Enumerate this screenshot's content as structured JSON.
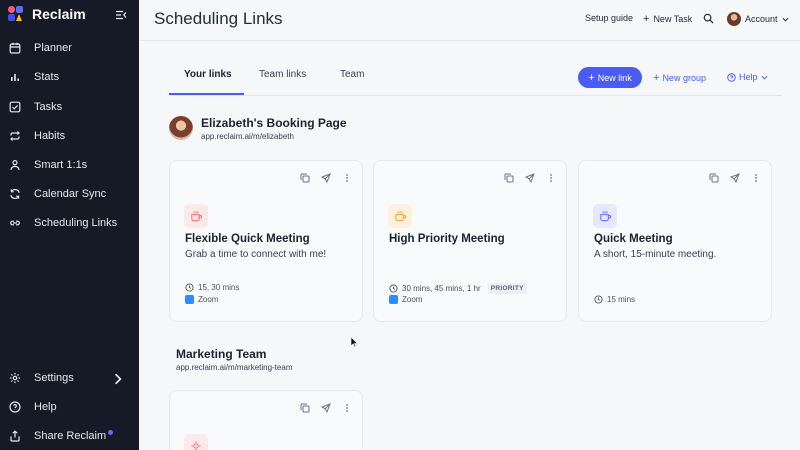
{
  "app": {
    "name": "Reclaim"
  },
  "sidebar": {
    "items": [
      {
        "label": "Planner",
        "icon": "calendar-icon"
      },
      {
        "label": "Stats",
        "icon": "bar-chart-icon"
      },
      {
        "label": "Tasks",
        "icon": "checkbox-icon"
      },
      {
        "label": "Habits",
        "icon": "repeat-icon"
      },
      {
        "label": "Smart 1:1s",
        "icon": "users-icon"
      },
      {
        "label": "Calendar Sync",
        "icon": "sync-icon"
      },
      {
        "label": "Scheduling Links",
        "icon": "link-icon"
      }
    ],
    "bottom": [
      {
        "label": "Settings",
        "icon": "gear-icon"
      },
      {
        "label": "Help",
        "icon": "help-circle-icon"
      },
      {
        "label": "Share Reclaim",
        "icon": "share-icon"
      }
    ]
  },
  "header": {
    "title": "Scheduling Links",
    "setup_guide": "Setup guide",
    "new_task": "New Task",
    "account": "Account"
  },
  "tabs": [
    {
      "label": "Your links",
      "active": true
    },
    {
      "label": "Team links",
      "active": false
    },
    {
      "label": "Team",
      "active": false
    }
  ],
  "actions": {
    "new_link": "New link",
    "new_group": "New group",
    "help": "Help"
  },
  "owner": {
    "name": "Elizabeth's Booking Page",
    "url": "app.reclaim.ai/m/elizabeth"
  },
  "cards": [
    {
      "title": "Flexible Quick Meeting",
      "description": "Grab a time to connect with me!",
      "durations": "15, 30 mins",
      "location": "Zoom",
      "mug_color": "#ff6b6b",
      "mug_bg": "#fde8ea"
    },
    {
      "title": "High Priority Meeting",
      "description": "",
      "durations": "30 mins, 45 mins, 1 hr",
      "badge": "PRIORITY",
      "location": "Zoom",
      "mug_color": "#f5a623",
      "mug_bg": "#fdf0dc"
    },
    {
      "title": "Quick Meeting",
      "description": "A short, 15-minute meeting.",
      "durations": "15 mins",
      "location": "",
      "mug_color": "#5b6cff",
      "mug_bg": "#e6e8ff"
    }
  ],
  "team": {
    "name": "Marketing Team",
    "url": "app.reclaim.ai/m/marketing-team"
  },
  "colors": {
    "sidebar_bg": "#161a27",
    "accent": "#4a5cf5",
    "zoom": "#2d8cff"
  }
}
